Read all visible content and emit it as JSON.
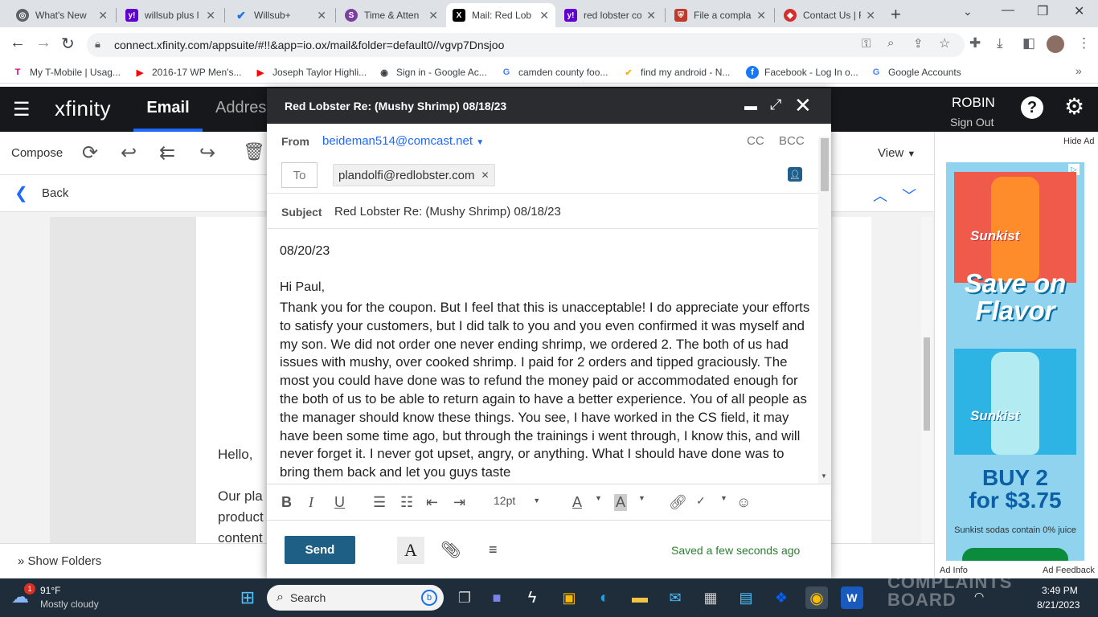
{
  "browser": {
    "tabs": [
      {
        "title": "What's New",
        "icon": "chrome-icon",
        "color": "#3c4043"
      },
      {
        "title": "willsub plus l",
        "icon": "yahoo-icon",
        "color": "#6001d2"
      },
      {
        "title": "Willsub+",
        "icon": "check-icon",
        "color": "#1a73e8"
      },
      {
        "title": "Time & Atten",
        "icon": "s-icon",
        "color": "#7b3fa0"
      },
      {
        "title": "Mail: Red Lob",
        "icon": "x-icon",
        "color": "#000"
      },
      {
        "title": "red lobster co",
        "icon": "yahoo-icon",
        "color": "#6001d2"
      },
      {
        "title": "File a compla",
        "icon": "shield-icon",
        "color": "#c0392b"
      },
      {
        "title": "Contact Us | F",
        "icon": "lobster-icon",
        "color": "#d32f2f"
      }
    ],
    "url": "connect.xfinity.com/appsuite/#!!&app=io.ox/mail&folder=default0//vgvp7Dnsjoo",
    "bookmarks": [
      {
        "label": "My T-Mobile | Usag...",
        "icon": "tmobile-icon",
        "glyph": "T",
        "color": "#e20074"
      },
      {
        "label": "2016-17 WP Men's...",
        "icon": "youtube-icon",
        "glyph": "▶",
        "color": "#ff0000"
      },
      {
        "label": "Joseph Taylor Highli...",
        "icon": "youtube-icon",
        "glyph": "▶",
        "color": "#ff0000"
      },
      {
        "label": "Sign in - Google Ac...",
        "icon": "globe-icon",
        "glyph": "◉",
        "color": "#3c4043"
      },
      {
        "label": "camden county foo...",
        "icon": "google-icon",
        "glyph": "G",
        "color": "#4285f4"
      },
      {
        "label": "find my android - N...",
        "icon": "check-icon",
        "glyph": "✔",
        "color": "#f4b400"
      },
      {
        "label": "Facebook - Log In o...",
        "icon": "facebook-icon",
        "glyph": "f",
        "color": "#1877f2"
      },
      {
        "label": "Google Accounts",
        "icon": "google-icon",
        "glyph": "G",
        "color": "#4285f4"
      }
    ]
  },
  "xfinity": {
    "logo": "xfinity",
    "nav": [
      "Email",
      "Addres"
    ],
    "user": "ROBIN",
    "signout": "Sign Out",
    "compose": "Compose",
    "view": "View",
    "back": "Back",
    "hide_ad": "Hide Ad",
    "show_folders": "Show Folders",
    "bg_email": [
      "Hello,",
      "Our pla",
      "product",
      "content"
    ]
  },
  "compose": {
    "title": "Red Lobster Re: (Mushy Shrimp) 08/18/23",
    "from_label": "From",
    "from_value": "beideman514@comcast.net",
    "cc": "CC",
    "bcc": "BCC",
    "to_label": "To",
    "to_value": "plandolfi@redlobster.com",
    "subject_label": "Subject",
    "subject_value": "Red Lobster Re: (Mushy Shrimp) 08/18/23",
    "date_line": "08/20/23",
    "greeting": "Hi Paul,",
    "body": "Thank you for the coupon. But I feel that this is unacceptable! I do appreciate your efforts to satisfy your customers, but I did talk to you and you even confirmed it was myself and my son. We did not order one never ending shrimp, we ordered 2. The both of us had issues with mushy, over cooked shrimp. I paid for 2 orders and tipped graciously. The most you could have done was to refund the money paid or accommodated enough for the both of us to be able to return again to have a better experience. You of all people as the manager should know these things. You see, I have worked in the CS field, it may have been some time ago, but through the trainings i went through, I know this, and will never forget it. I never got upset, angry, or anything. What I should have done was to bring them back and let you guys taste",
    "font_size": "12pt",
    "send": "Send",
    "saved": "Saved a few seconds ago"
  },
  "ad": {
    "brand": "Sunkist",
    "headline": "Save on Flavor",
    "offer_line1": "BUY 2",
    "offer_line2": "for $3.75",
    "fine": "Sunkist sodas contain 0% juice",
    "ad_info": "Ad Info",
    "ad_feedback": "Ad Feedback"
  },
  "taskbar": {
    "temp": "91°F",
    "weather": "Mostly cloudy",
    "badge": "1",
    "search": "Search",
    "time": "3:49 PM",
    "date": "8/21/2023",
    "watermark": "COMPLAINTS BOARD"
  }
}
